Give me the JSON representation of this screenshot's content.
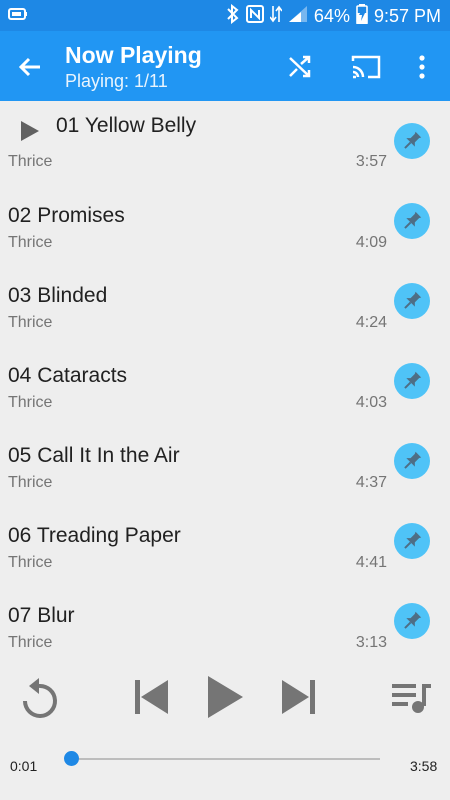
{
  "status_bar": {
    "battery_percent": "64%",
    "time": "9:57 PM"
  },
  "toolbar": {
    "title": "Now Playing",
    "subtitle": "Playing: 1/11"
  },
  "playlist": {
    "tracks": [
      {
        "title": "01 Yellow Belly",
        "artist": "Thrice",
        "duration": "3:57",
        "playing": true
      },
      {
        "title": "02 Promises",
        "artist": "Thrice",
        "duration": "4:09",
        "playing": false
      },
      {
        "title": "03 Blinded",
        "artist": "Thrice",
        "duration": "4:24",
        "playing": false
      },
      {
        "title": "04 Cataracts",
        "artist": "Thrice",
        "duration": "4:03",
        "playing": false
      },
      {
        "title": "05 Call It In the Air",
        "artist": "Thrice",
        "duration": "4:37",
        "playing": false
      },
      {
        "title": "06 Treading Paper",
        "artist": "Thrice",
        "duration": "4:41",
        "playing": false
      },
      {
        "title": "07 Blur",
        "artist": "Thrice",
        "duration": "3:13",
        "playing": false
      }
    ]
  },
  "player": {
    "elapsed": "0:01",
    "total": "3:58",
    "progress_fraction": 0.004
  },
  "colors": {
    "status_bar": "#1e88e5",
    "toolbar": "#2196f3",
    "pin_button": "#4fc3f7",
    "accent": "#1e88e5"
  }
}
